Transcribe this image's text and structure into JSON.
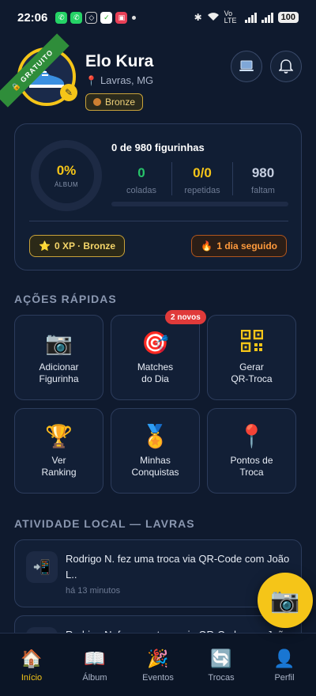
{
  "status_bar": {
    "time": "22:06",
    "network": "Vo LTE",
    "battery": "100"
  },
  "profile": {
    "badge": "GRATUITO",
    "name": "Elo Kura",
    "location": "Lavras, MG",
    "tier": "Bronze"
  },
  "album": {
    "percent": "0%",
    "ring_label": "ÁLBUM",
    "title": "0 de 980 figurinhas",
    "progress": 0,
    "stats": [
      {
        "value": "0",
        "label": "coladas"
      },
      {
        "value": "0/0",
        "label": "repetidas"
      },
      {
        "value": "980",
        "label": "faltam"
      }
    ],
    "xp": "0 XP · Bronze",
    "streak": "1 dia seguido"
  },
  "quick_actions": {
    "title": "AÇÕES RÁPIDAS",
    "new_badge": "2 novos",
    "items": [
      {
        "label": "Adicionar\nFigurinha",
        "icon": "camera-icon"
      },
      {
        "label": "Matches\ndo Dia",
        "icon": "target-icon"
      },
      {
        "label": "Gerar\nQR-Troca",
        "icon": "qr-code-icon"
      },
      {
        "label": "Ver\nRanking",
        "icon": "trophy-icon"
      },
      {
        "label": "Minhas\nConquistas",
        "icon": "medal-icon"
      },
      {
        "label": "Pontos de\nTroca",
        "icon": "pin-icon"
      }
    ]
  },
  "activity": {
    "title": "ATIVIDADE LOCAL — LAVRAS",
    "items": [
      {
        "text": "Rodrigo N. fez uma troca via QR-Code com João L..",
        "time": "há 13 minutos"
      },
      {
        "text": "Rodrigo N. fez uma troca via QR-Code com João",
        "time": ""
      }
    ]
  },
  "nav": [
    {
      "label": "Início",
      "icon": "home-icon",
      "active": true
    },
    {
      "label": "Álbum",
      "icon": "book-icon",
      "active": false
    },
    {
      "label": "Eventos",
      "icon": "party-icon",
      "active": false
    },
    {
      "label": "Trocas",
      "icon": "swap-icon",
      "active": false
    },
    {
      "label": "Perfil",
      "icon": "user-icon",
      "active": false
    }
  ],
  "colors": {
    "background": "#0f1a2e",
    "accent": "#f5c518",
    "green": "#27c46a",
    "badge_red": "#e03a3a"
  }
}
